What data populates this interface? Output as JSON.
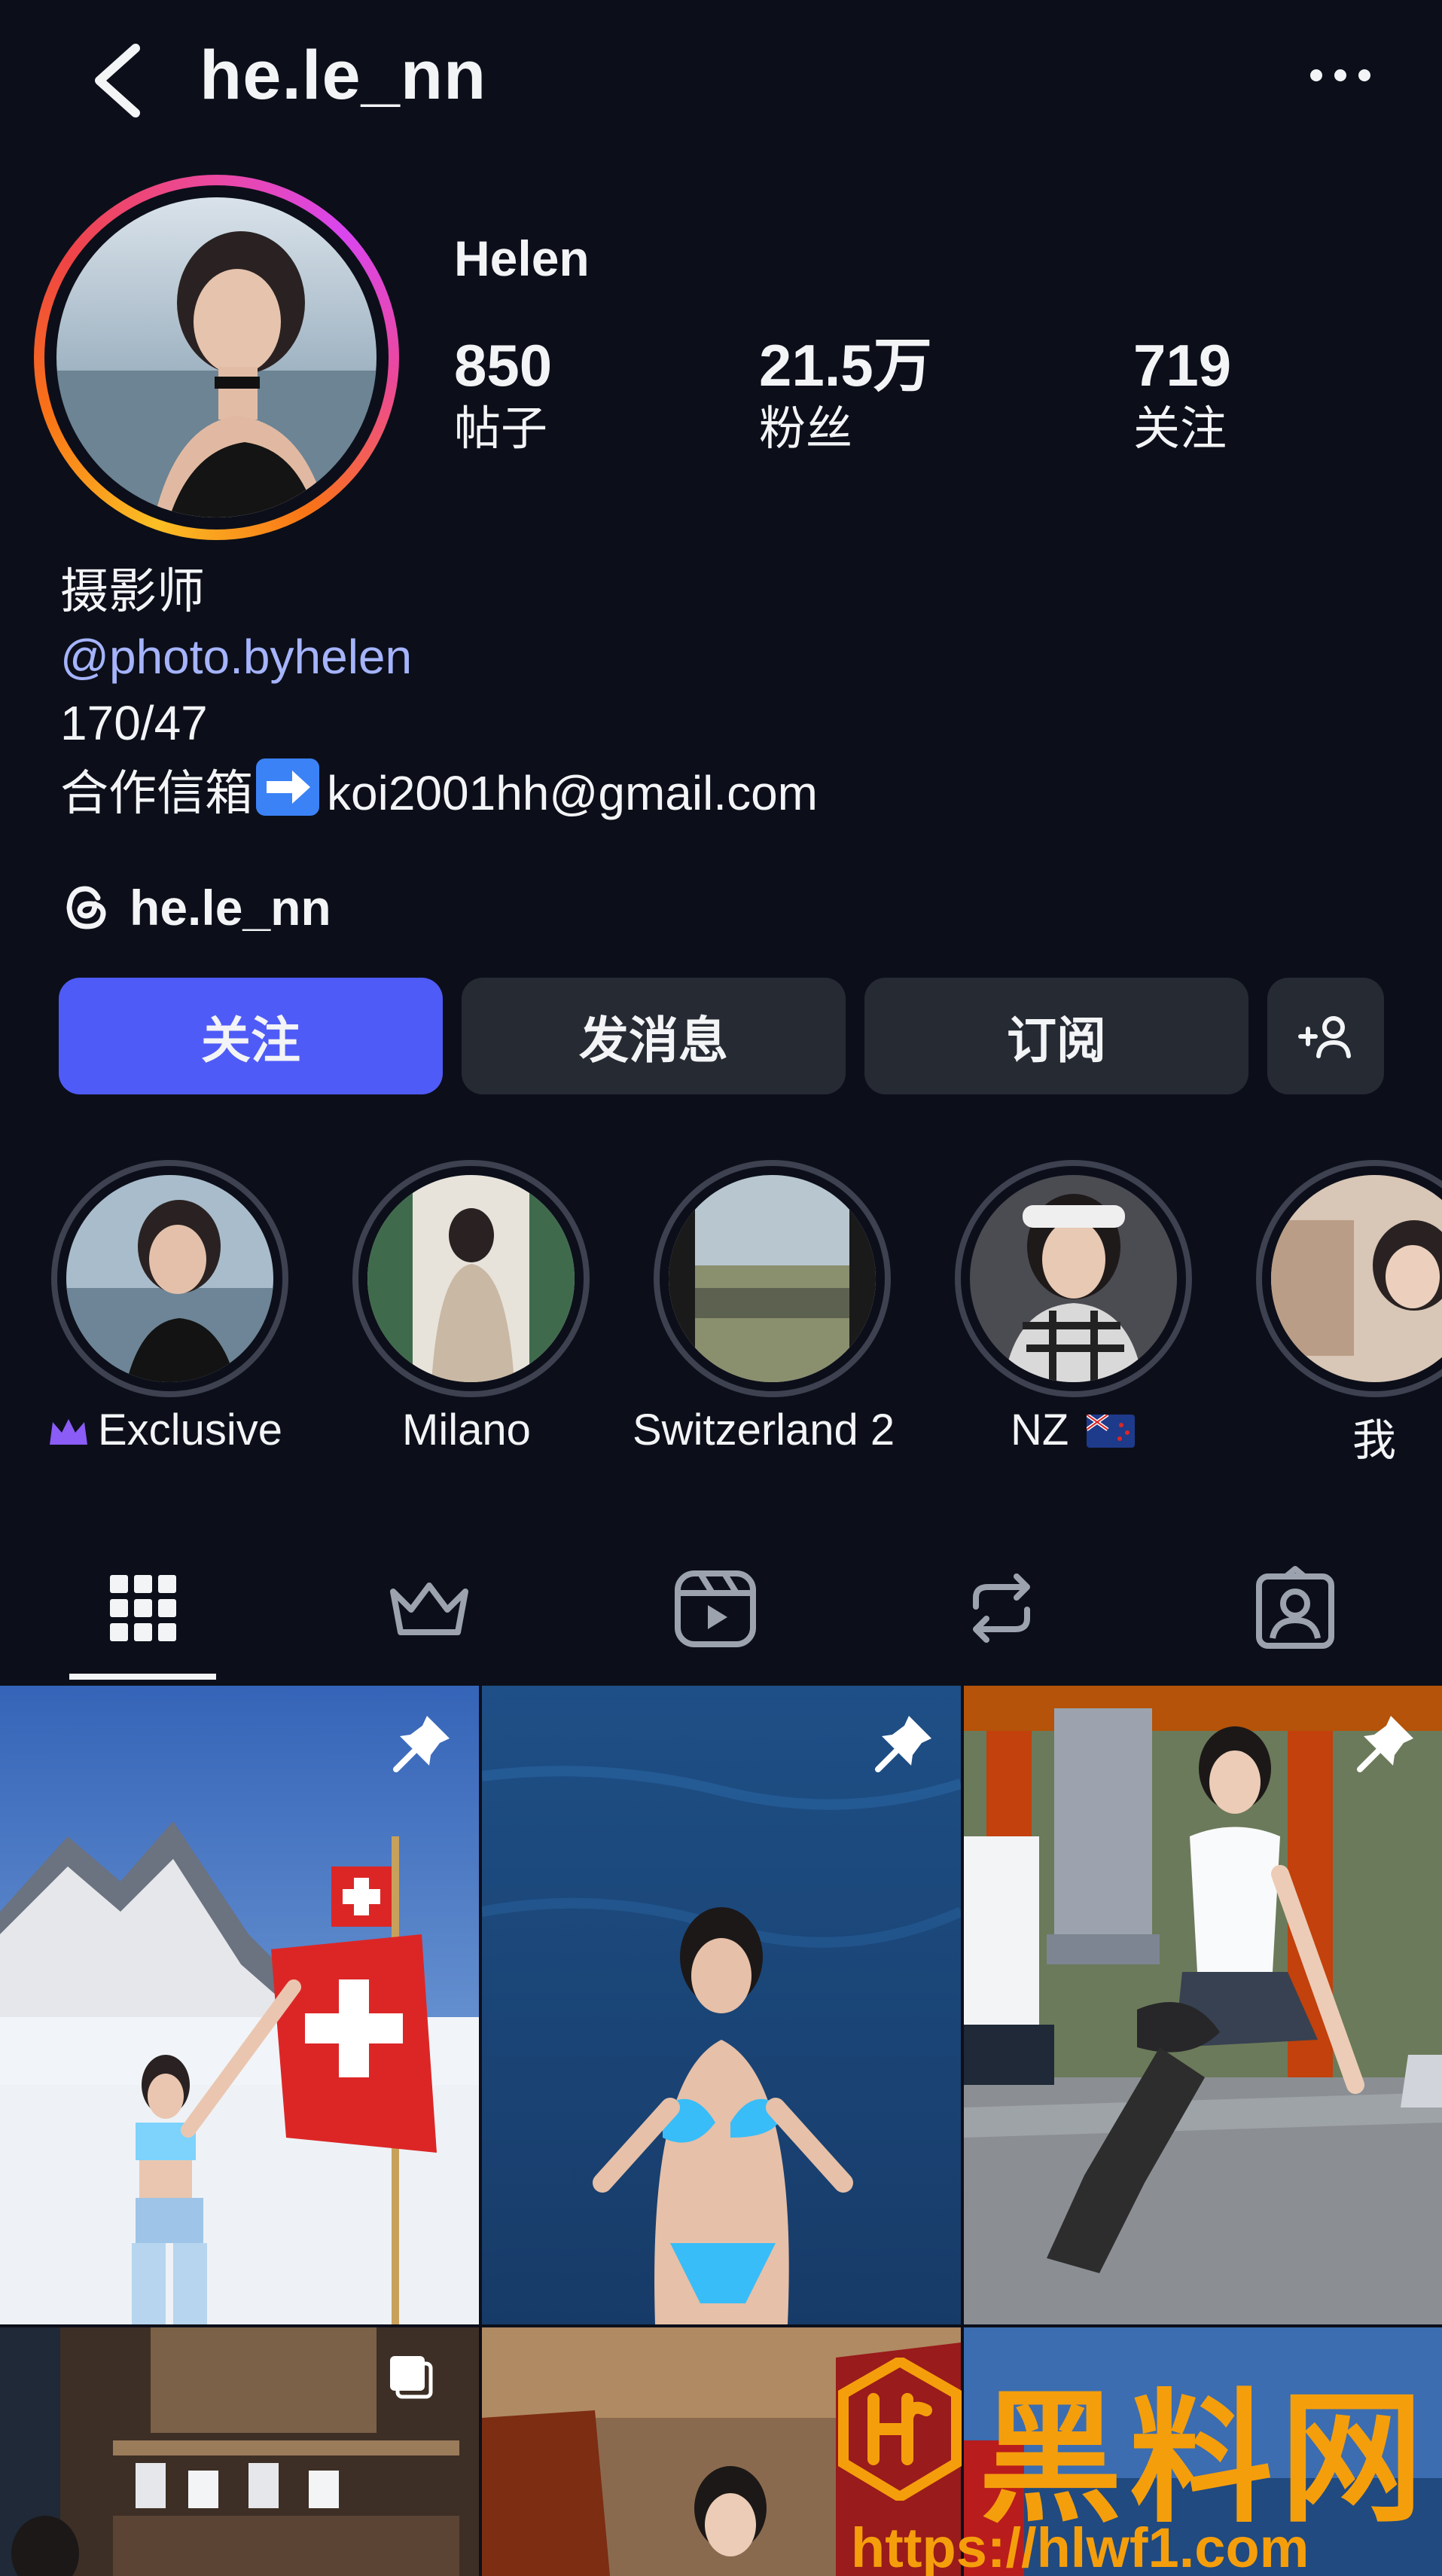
{
  "header": {
    "username": "he.le_nn",
    "back_icon": "chevron-left-icon",
    "more_icon": "more-horizontal-icon"
  },
  "profile": {
    "display_name": "Helen",
    "stats": [
      {
        "value": "850",
        "label": "帖子"
      },
      {
        "value": "21.5万",
        "label": "粉丝"
      },
      {
        "value": "719",
        "label": "关注"
      }
    ],
    "bio": {
      "line1": "摄影师",
      "link": "@photo.byhelen",
      "line3": "170/47",
      "line4_prefix": "合作信箱",
      "line4_email": "koi2001hh@gmail.com"
    },
    "threads_handle": "he.le_nn"
  },
  "actions": {
    "follow": "关注",
    "message": "发消息",
    "subscribe": "订阅",
    "add_user_icon": "person-add-icon"
  },
  "highlights": [
    {
      "label": "Exclusive",
      "icon": "crown-icon"
    },
    {
      "label": "Milano"
    },
    {
      "label": "Switzerland 2"
    },
    {
      "label": "NZ",
      "flag": "nz-flag-icon"
    },
    {
      "label": "我"
    }
  ],
  "tabs": [
    {
      "icon": "grid-icon",
      "active": true
    },
    {
      "icon": "crown-icon"
    },
    {
      "icon": "reels-icon"
    },
    {
      "icon": "repost-icon"
    },
    {
      "icon": "tagged-icon"
    }
  ],
  "watermark": {
    "title": "黑料网",
    "url": "https://hlwf1.com"
  },
  "colors": {
    "background": "#0c0f1a",
    "follow_button": "#4f5bf7",
    "secondary_button": "#262a33",
    "link": "#a5b4fc",
    "watermark": "#f59e0b"
  }
}
